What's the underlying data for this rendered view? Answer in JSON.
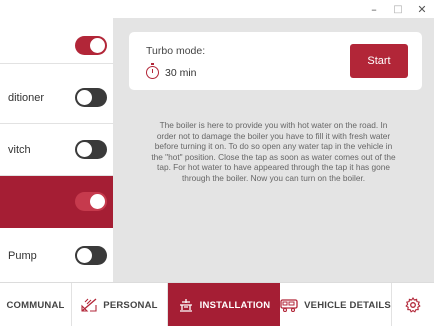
{
  "window": {
    "minimize": "–",
    "maximize": "□",
    "close": "✕"
  },
  "left_panel": {
    "rows": [
      {
        "label": "",
        "state": "on"
      },
      {
        "label": "ditioner",
        "state": "off"
      },
      {
        "label": "vitch",
        "state": "off"
      },
      {
        "label": "",
        "state": "on",
        "active": true
      },
      {
        "label": "Pump",
        "state": "off"
      }
    ]
  },
  "turbo": {
    "label": "Turbo mode:",
    "time": "30 min",
    "start_label": "Start"
  },
  "info": "The boiler is here to provide you with hot water on the road. In order not to damage the boiler you have to fill it with fresh water before turning it on. To do so open any water tap in the vehicle in the \"hot\" position. Close the tap as soon as water comes out of the tap. For hot water to have appeared through the tap it has gone through the boiler. Now you can turn on the boiler.",
  "nav": {
    "communal": "COMMUNAL",
    "personal": "PERSONAL",
    "installation": "INSTALLATION",
    "vehicle_details": "VEHICLE DETAILS"
  },
  "colors": {
    "accent": "#b22638",
    "active_row": "#a51e34",
    "panel_bg": "#e4e4e4"
  },
  "icons": [
    "personal-icon",
    "installation-icon",
    "vehicle-icon",
    "settings-gear-icon",
    "timer-icon"
  ]
}
